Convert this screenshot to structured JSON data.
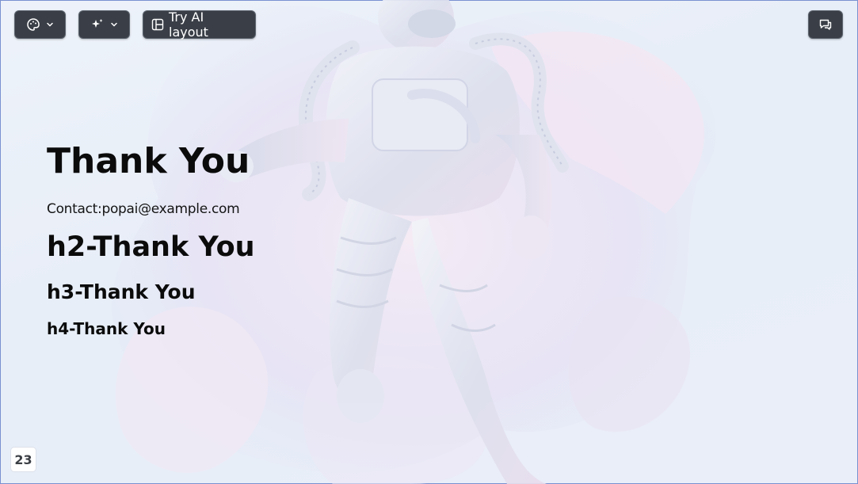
{
  "toolbar": {
    "theme_icon": "palette-icon",
    "magic_icon": "sparkles-icon",
    "ai_layout_icon": "layout-icon",
    "ai_layout_label": "Try AI layout",
    "comment_icon": "comment-icon"
  },
  "slide": {
    "title": "Thank You",
    "contact": "Contact:popai@example.com",
    "h2": "h2-Thank You",
    "h3": "h3-Thank You",
    "h4": "h4-Thank You",
    "background_image": "astronaut-floating-illustration",
    "page_number": "23"
  },
  "colors": {
    "toolbar_bg": "#3a3f47",
    "heading": "#0b0b0b",
    "background": "#e9eef8"
  }
}
